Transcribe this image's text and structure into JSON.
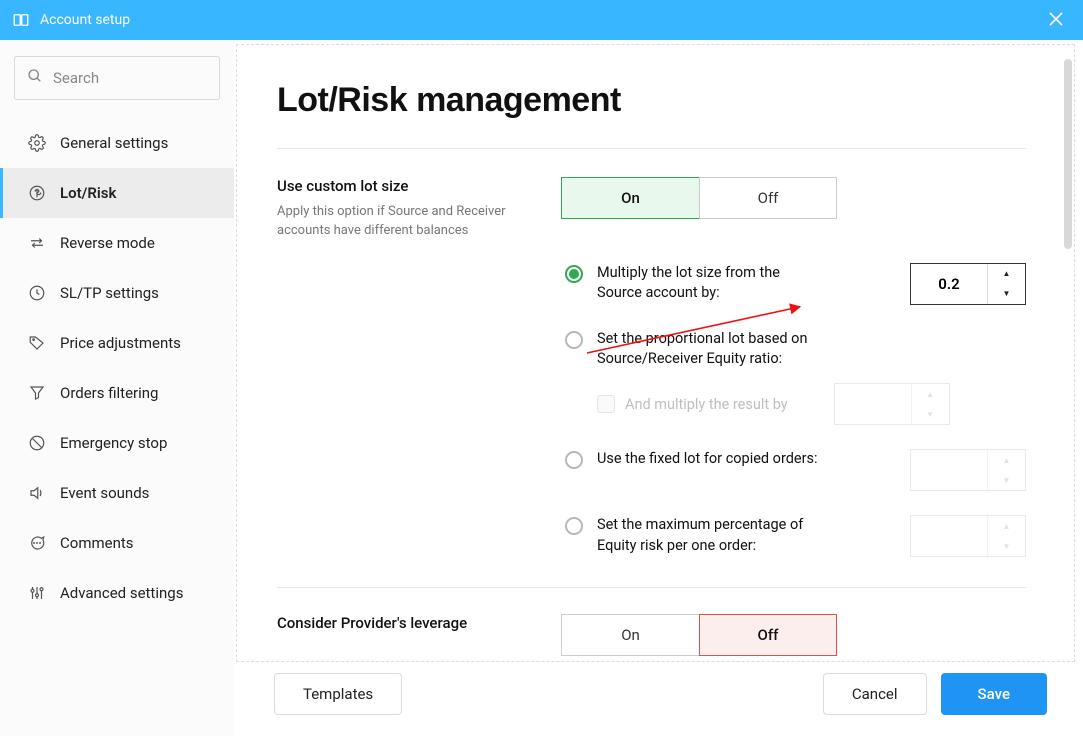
{
  "window": {
    "title": "Account setup"
  },
  "sidebar": {
    "search_placeholder": "Search",
    "items": [
      {
        "label": "General settings",
        "icon": "cog"
      },
      {
        "label": "Lot/Risk",
        "icon": "dollar-circle",
        "active": true
      },
      {
        "label": "Reverse mode",
        "icon": "swap"
      },
      {
        "label": "SL/TP settings",
        "icon": "clock"
      },
      {
        "label": "Price adjustments",
        "icon": "tag"
      },
      {
        "label": "Orders filtering",
        "icon": "funnel"
      },
      {
        "label": "Emergency stop",
        "icon": "ban"
      },
      {
        "label": "Event sounds",
        "icon": "volume"
      },
      {
        "label": "Comments",
        "icon": "chat"
      },
      {
        "label": "Advanced settings",
        "icon": "sliders"
      }
    ]
  },
  "page": {
    "title": "Lot/Risk management",
    "custom_lot": {
      "label": "Use custom lot size",
      "sub": "Apply this option if Source and Receiver accounts have different balances",
      "value": "on",
      "on_label": "On",
      "off_label": "Off",
      "options": {
        "multiply": {
          "label": "Multiply the lot size from the Source account by:",
          "value": "0.2",
          "selected": true
        },
        "proportional": {
          "label": "Set the proportional lot based on Source/Receiver Equity ratio:",
          "sub_check_label": "And multiply the result by",
          "value": "",
          "selected": false
        },
        "fixed": {
          "label": "Use the fixed lot for copied orders:",
          "value": "",
          "selected": false
        },
        "max_equity": {
          "label": "Set the maximum percentage of Equity risk per one order:",
          "value": "",
          "selected": false
        }
      }
    },
    "provider_leverage": {
      "label": "Consider Provider's leverage",
      "value": "off",
      "on_label": "On",
      "off_label": "Off"
    }
  },
  "footer": {
    "templates": "Templates",
    "cancel": "Cancel",
    "save": "Save"
  }
}
